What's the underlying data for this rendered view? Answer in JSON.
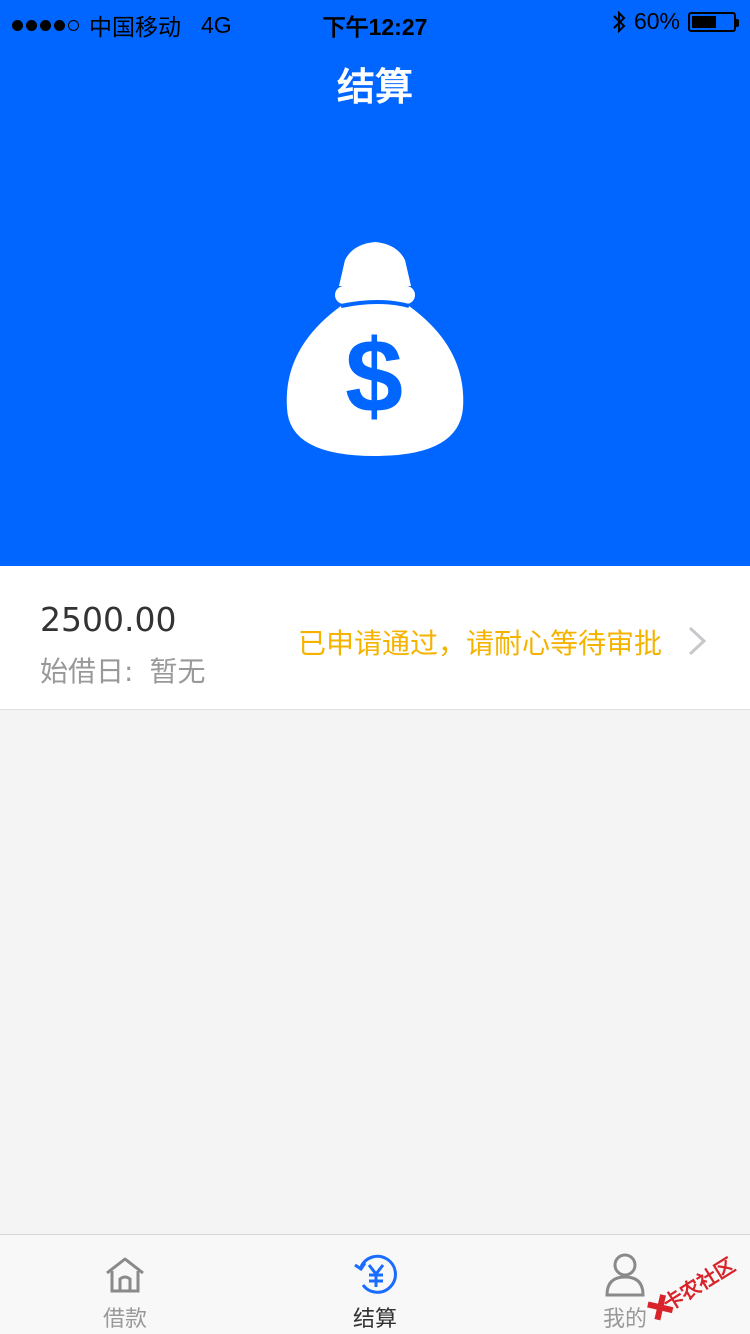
{
  "status_bar": {
    "carrier": "中国移动",
    "network": "4G",
    "time": "下午12:27",
    "battery": "60%",
    "battery_level": 0.6
  },
  "header": {
    "title": "结算"
  },
  "loan": {
    "amount": "2500.00",
    "start_date_label": "始借日:",
    "start_date_value": "暂无",
    "status": "已申请通过，请耐心等待审批"
  },
  "tabs": [
    {
      "label": "借款",
      "icon": "home-icon"
    },
    {
      "label": "结算",
      "icon": "settle-yen-icon"
    },
    {
      "label": "我的",
      "icon": "user-icon"
    }
  ],
  "watermark": "卡农社区",
  "colors": {
    "primary": "#0066ff",
    "status": "#f5b300",
    "background": "#f4f4f4"
  }
}
